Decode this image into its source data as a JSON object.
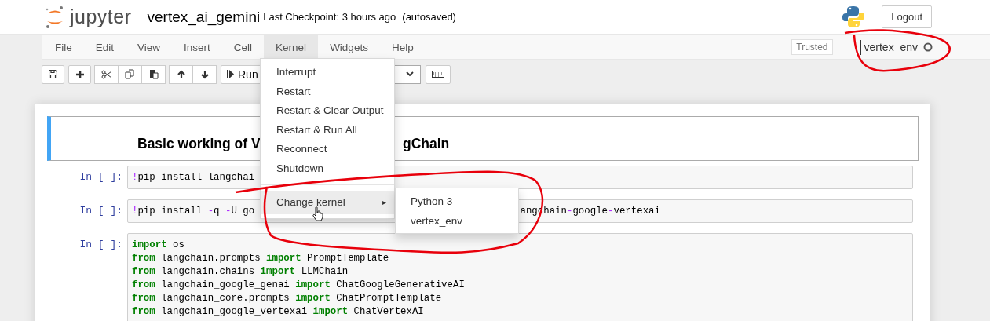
{
  "header": {
    "logo_text": "jupyter",
    "notebook_name": "vertex_ai_gemini",
    "checkpoint": "Last Checkpoint: 3 hours ago",
    "autosaved": "(autosaved)",
    "logout": "Logout"
  },
  "menubar": {
    "items": [
      {
        "label": "File",
        "selected": false
      },
      {
        "label": "Edit",
        "selected": false
      },
      {
        "label": "View",
        "selected": false
      },
      {
        "label": "Insert",
        "selected": false
      },
      {
        "label": "Cell",
        "selected": false
      },
      {
        "label": "Kernel",
        "selected": true
      },
      {
        "label": "Widgets",
        "selected": false
      },
      {
        "label": "Help",
        "selected": false
      }
    ],
    "trusted": "Trusted",
    "kernel_name": "vertex_env",
    "kernel_busy": false
  },
  "toolbar": {
    "run_label": "Run"
  },
  "kernel_menu": {
    "items": [
      {
        "kind": "item",
        "label": "Interrupt"
      },
      {
        "kind": "item",
        "label": "Restart"
      },
      {
        "kind": "item",
        "label": "Restart & Clear Output"
      },
      {
        "kind": "item",
        "label": "Restart & Run All"
      },
      {
        "kind": "item",
        "label": "Reconnect"
      },
      {
        "kind": "item",
        "label": "Shutdown"
      },
      {
        "kind": "divider"
      },
      {
        "kind": "submenu",
        "label": "Change kernel",
        "arrow": "▸",
        "highlighted": true
      }
    ],
    "submenu": [
      "Python 3",
      "vertex_env"
    ]
  },
  "cells": [
    {
      "kind": "markdown",
      "heading_parts": [
        "Basic working of V",
        "gChain"
      ]
    },
    {
      "kind": "code",
      "prompt": "In [ ]:",
      "lines": [
        [
          [
            {
              "kind": "op",
              "t": "!"
            },
            {
              "kind": "text",
              "t": "pip install langchai"
            }
          ]
        ]
      ]
    },
    {
      "kind": "code",
      "prompt": "In [ ]:",
      "lines": [
        [
          [
            {
              "kind": "op",
              "t": "!"
            },
            {
              "kind": "text",
              "t": "pip install "
            },
            {
              "kind": "op",
              "t": "-"
            },
            {
              "kind": "text",
              "t": "q "
            },
            {
              "kind": "op",
              "t": "-"
            },
            {
              "kind": "text",
              "t": "U go"
            }
          ],
          [
            {
              "kind": "text",
              "t": "angchain"
            },
            {
              "kind": "op",
              "t": "-"
            },
            {
              "kind": "text",
              "t": "google"
            },
            {
              "kind": "op",
              "t": "-"
            },
            {
              "kind": "text",
              "t": "vertexai"
            }
          ]
        ]
      ]
    },
    {
      "kind": "code",
      "prompt": "In [ ]:",
      "lines": [
        [
          [
            {
              "kind": "kw",
              "t": "import"
            },
            {
              "kind": "text",
              "t": " os"
            }
          ]
        ],
        [
          [
            {
              "kind": "kw",
              "t": "from"
            },
            {
              "kind": "text",
              "t": " langchain.prompts "
            },
            {
              "kind": "kw",
              "t": "import"
            },
            {
              "kind": "text",
              "t": " PromptTemplate"
            }
          ]
        ],
        [
          [
            {
              "kind": "kw",
              "t": "from"
            },
            {
              "kind": "text",
              "t": " langchain.chains "
            },
            {
              "kind": "kw",
              "t": "import"
            },
            {
              "kind": "text",
              "t": " LLMChain"
            }
          ]
        ],
        [
          [
            {
              "kind": "kw",
              "t": "from"
            },
            {
              "kind": "text",
              "t": " langchain_google_genai "
            },
            {
              "kind": "kw",
              "t": "import"
            },
            {
              "kind": "text",
              "t": " ChatGoogleGenerativeAI"
            }
          ]
        ],
        [
          [
            {
              "kind": "kw",
              "t": "from"
            },
            {
              "kind": "text",
              "t": " langchain_core.prompts "
            },
            {
              "kind": "kw",
              "t": "import"
            },
            {
              "kind": "text",
              "t": " ChatPromptTemplate"
            }
          ]
        ],
        [
          [
            {
              "kind": "kw",
              "t": "from"
            },
            {
              "kind": "text",
              "t": " langchain_google_vertexai "
            },
            {
              "kind": "kw",
              "t": "import"
            },
            {
              "kind": "text",
              "t": " ChatVertexAI"
            }
          ]
        ]
      ]
    }
  ]
}
